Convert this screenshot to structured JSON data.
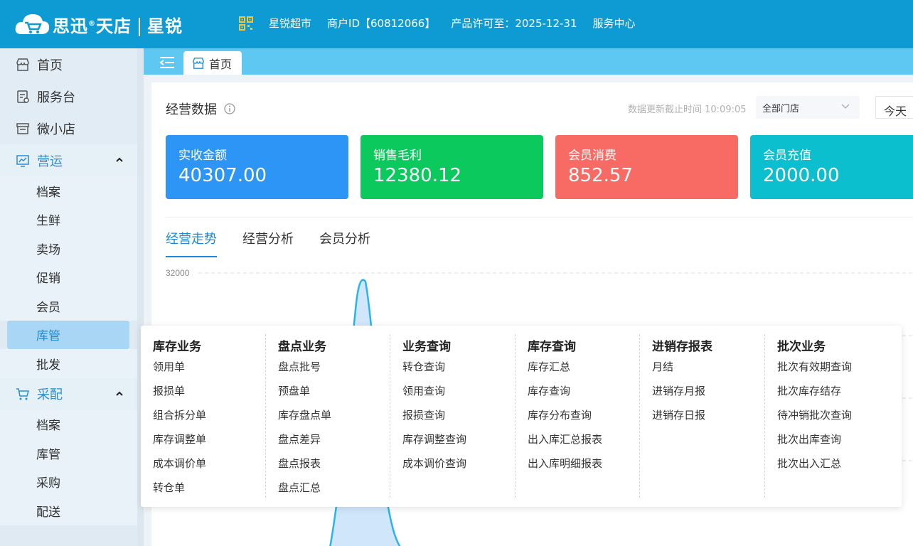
{
  "header": {
    "brand_main": "思迅",
    "brand_reg": "®",
    "brand_sub": "天店",
    "brand_product": "星锐",
    "store_name": "星锐超市",
    "merchant_id": "商户ID【60812066】",
    "license": "产品许可至：2025-12-31",
    "service": "服务中心"
  },
  "sidebar": {
    "top_items": [
      {
        "label": "首页",
        "icon": "store-icon"
      },
      {
        "label": "服务台",
        "icon": "service-desk-icon"
      },
      {
        "label": "微小店",
        "icon": "shop-icon"
      }
    ],
    "group1": {
      "label": "营运",
      "icon": "chart-icon",
      "items": [
        "档案",
        "生鲜",
        "卖场",
        "促销",
        "会员",
        "库管",
        "批发"
      ],
      "active": "库管"
    },
    "group2": {
      "label": "采配",
      "icon": "cart-icon",
      "items": [
        "档案",
        "库管",
        "采购",
        "配送"
      ]
    }
  },
  "tabs": {
    "home": "首页"
  },
  "dashboard": {
    "title": "经营数据",
    "update_time": "数据更新截止时间 10:09:05",
    "store_select": "全部门店",
    "period": "今天",
    "stats": [
      {
        "label": "实收金额",
        "value": "40307.00",
        "color": "#2d95f5"
      },
      {
        "label": "销售毛利",
        "value": "12380.12",
        "color": "#0cc95d"
      },
      {
        "label": "会员消费",
        "value": "852.57",
        "color": "#f86b64"
      },
      {
        "label": "会员充值",
        "value": "2000.00",
        "color": "#0bbfcf"
      }
    ],
    "chart_tabs": [
      "经营走势",
      "经营分析",
      "会员分析"
    ]
  },
  "chart_data": {
    "type": "area",
    "y_tick_labels": [
      "32000"
    ]
  },
  "menu": {
    "columns": [
      {
        "title": "库存业务",
        "items": [
          "领用单",
          "报损单",
          "组合拆分单",
          "库存调整单",
          "成本调价单",
          "转仓单"
        ]
      },
      {
        "title": "盘点业务",
        "items": [
          "盘点批号",
          "预盘单",
          "库存盘点单",
          "盘点差异",
          "盘点报表",
          "盘点汇总"
        ]
      },
      {
        "title": "业务查询",
        "items": [
          "转仓查询",
          "领用查询",
          "报损查询",
          "库存调整查询",
          "成本调价查询"
        ]
      },
      {
        "title": "库存查询",
        "items": [
          "库存汇总",
          "库存查询",
          "库存分布查询",
          "出入库汇总报表",
          "出入库明细报表"
        ]
      },
      {
        "title": "进销存报表",
        "items": [
          "月结",
          "进销存月报",
          "进销存日报"
        ]
      },
      {
        "title": "批次业务",
        "items": [
          "批次有效期查询",
          "批次库存结存",
          "待冲销批次查询",
          "批次出库查询",
          "批次出入汇总"
        ]
      }
    ]
  }
}
